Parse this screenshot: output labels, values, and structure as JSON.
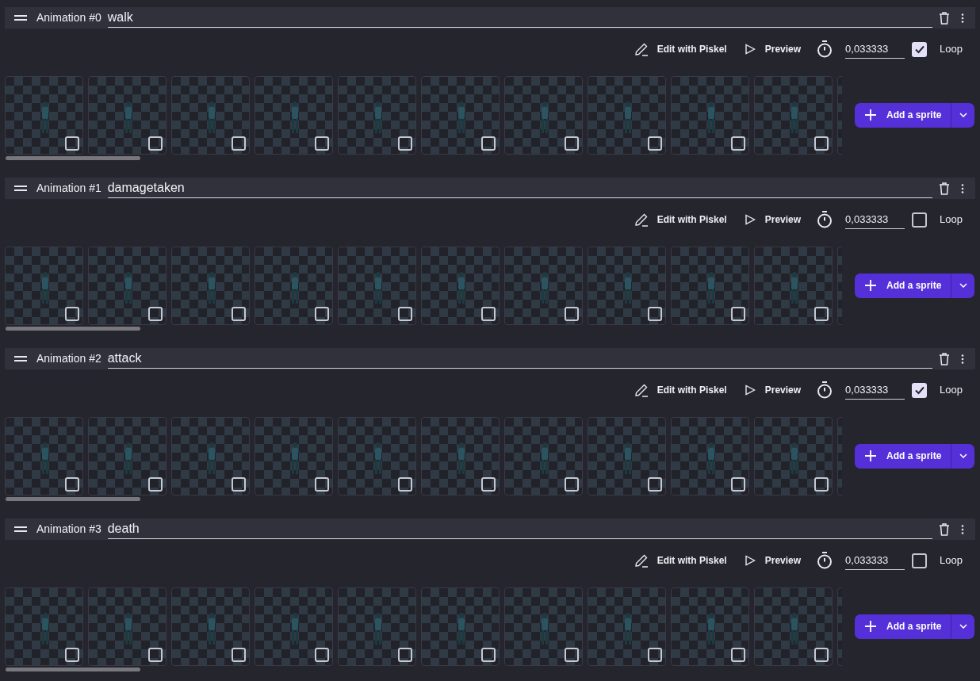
{
  "animations": [
    {
      "label": "Animation #0",
      "name": "walk",
      "edit_label": "Edit with Piskel",
      "preview_label": "Preview",
      "duration": "0,033333",
      "loop_label": "Loop",
      "loop": true,
      "add_label": "Add a sprite",
      "frames": [
        {
          "checked": false
        },
        {
          "checked": false
        },
        {
          "checked": false
        },
        {
          "checked": false
        },
        {
          "checked": false
        },
        {
          "checked": false
        },
        {
          "checked": false
        },
        {
          "checked": false
        },
        {
          "checked": false
        },
        {
          "checked": false
        }
      ]
    },
    {
      "label": "Animation #1",
      "name": "damagetaken",
      "edit_label": "Edit with Piskel",
      "preview_label": "Preview",
      "duration": "0,033333",
      "loop_label": "Loop",
      "loop": false,
      "add_label": "Add a sprite",
      "frames": [
        {
          "checked": false
        },
        {
          "checked": false
        },
        {
          "checked": false
        },
        {
          "checked": false
        },
        {
          "checked": false
        },
        {
          "checked": false
        },
        {
          "checked": false
        },
        {
          "checked": false
        },
        {
          "checked": false
        },
        {
          "checked": false
        }
      ]
    },
    {
      "label": "Animation #2",
      "name": "attack",
      "edit_label": "Edit with Piskel",
      "preview_label": "Preview",
      "duration": "0,033333",
      "loop_label": "Loop",
      "loop": true,
      "add_label": "Add a sprite",
      "frames": [
        {
          "checked": false
        },
        {
          "checked": false
        },
        {
          "checked": false
        },
        {
          "checked": false
        },
        {
          "checked": false
        },
        {
          "checked": false
        },
        {
          "checked": false
        },
        {
          "checked": false
        },
        {
          "checked": false
        },
        {
          "checked": false
        }
      ]
    },
    {
      "label": "Animation #3",
      "name": "death",
      "edit_label": "Edit with Piskel",
      "preview_label": "Preview",
      "duration": "0,033333",
      "loop_label": "Loop",
      "loop": false,
      "add_label": "Add a sprite",
      "frames": [
        {
          "checked": false
        },
        {
          "checked": false
        },
        {
          "checked": false
        },
        {
          "checked": false
        },
        {
          "checked": false
        },
        {
          "checked": false
        },
        {
          "checked": false
        },
        {
          "checked": false
        },
        {
          "checked": false
        },
        {
          "checked": false
        }
      ]
    }
  ]
}
